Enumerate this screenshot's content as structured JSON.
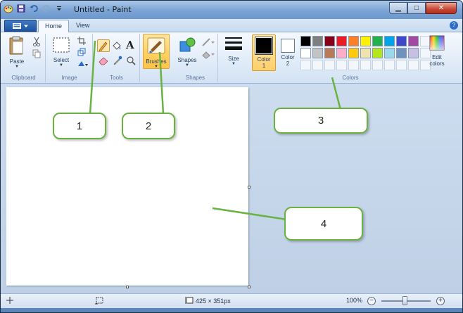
{
  "window": {
    "title": "Untitled - Paint",
    "controls": {
      "minimize": "▁",
      "maximize": "□",
      "close": "✕"
    }
  },
  "tabs": [
    {
      "label": "Home",
      "active": true
    },
    {
      "label": "View",
      "active": false
    }
  ],
  "help_glyph": "?",
  "ribbon": {
    "clipboard": {
      "paste": "Paste",
      "group": "Clipboard"
    },
    "image": {
      "select": "Select",
      "group": "Image"
    },
    "tools": {
      "text_glyph": "A",
      "group": "Tools"
    },
    "brushes": {
      "label": "Brushes"
    },
    "shapes": {
      "label": "Shapes",
      "group": "Shapes"
    },
    "size": {
      "label": "Size"
    },
    "color1": {
      "line1": "Color",
      "line2": "1"
    },
    "color2": {
      "line1": "Color",
      "line2": "2"
    },
    "colors": {
      "group": "Colors"
    },
    "edit_colors": {
      "line1": "Edit",
      "line2": "colors"
    }
  },
  "palette_row1": [
    "#000000",
    "#7f7f7f",
    "#880015",
    "#ed1c24",
    "#ff7f27",
    "#fff200",
    "#22b14c",
    "#00a2e8",
    "#3f48cc",
    "#a349a4"
  ],
  "palette_row2": [
    "#ffffff",
    "#c3c3c3",
    "#b97a57",
    "#ffaec9",
    "#ffc90e",
    "#efe4b0",
    "#b5e61d",
    "#99d9ea",
    "#7092be",
    "#c8bfe7"
  ],
  "colors": {
    "color1": "#000000",
    "color2": "#ffffff",
    "accent_green": "#6ab340",
    "brush_highlight": "#ffd266"
  },
  "callouts": [
    "1",
    "2",
    "3",
    "4"
  ],
  "status": {
    "dimensions": "425 × 351px",
    "zoom": "100%",
    "zoom_minus": "−",
    "zoom_plus": "+"
  }
}
